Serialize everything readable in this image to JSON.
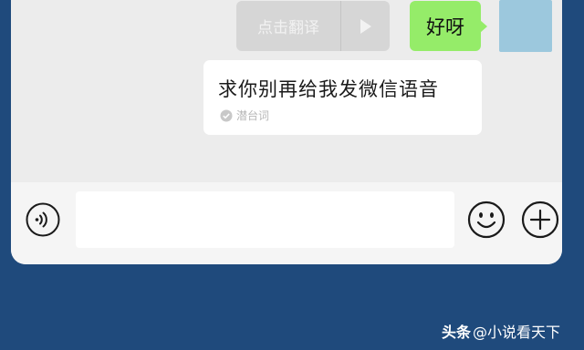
{
  "chat": {
    "translate_label": "点击翻译",
    "my_message": "好呀",
    "other_message": "求你别再给我发微信语音",
    "other_source": "潜台词"
  },
  "input": {
    "placeholder": ""
  },
  "icons": {
    "play": "play-icon",
    "voice": "voice-icon",
    "emoji": "emoji-icon",
    "plus": "plus-icon",
    "check": "check-icon"
  },
  "colors": {
    "my_bubble": "#95ec69",
    "background": "#1f4a7c"
  },
  "watermark": {
    "brand": "头条",
    "handle": "@小说看天下"
  }
}
